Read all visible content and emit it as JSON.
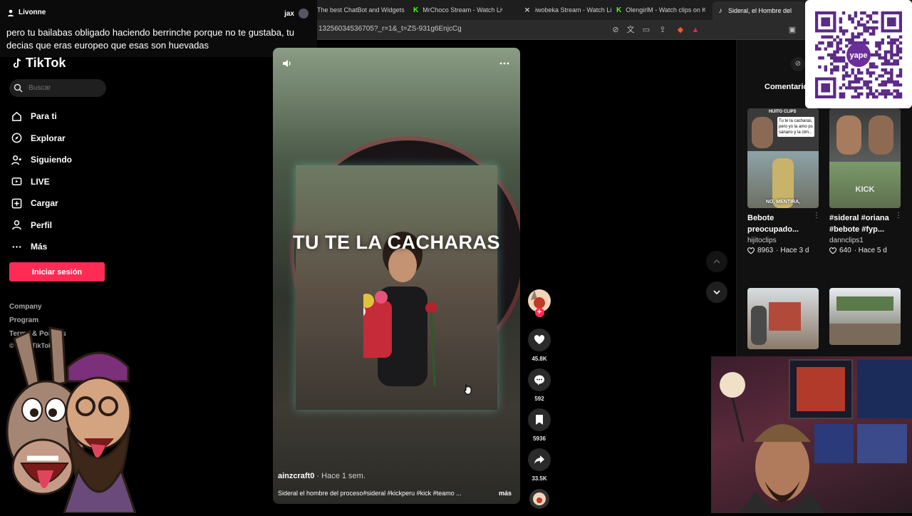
{
  "chat": {
    "user": "Livonne",
    "user2": "jax",
    "message": "pero tu bailabas obligado haciendo berrinche porque no te gustaba, tu decias que eras europeo que esas son huevadas"
  },
  "browser": {
    "tabs": [
      {
        "label": "The best ChatBot and Widgets"
      },
      {
        "label": "MrChoco Stream - Watch Live"
      },
      {
        "label": "iwobeka Stream - Watch Li"
      },
      {
        "label": "OlengirlM - Watch clips on Kic"
      },
      {
        "label": "Sideral, el Hombre del"
      }
    ],
    "url": "13256034536705?_r=1&_t=ZS-931g6EnjcCg"
  },
  "sidebar": {
    "logo": "TikTok",
    "search_placeholder": "Buscar",
    "items": [
      {
        "label": "Para ti",
        "icon": "home-icon"
      },
      {
        "label": "Explorar",
        "icon": "compass-icon"
      },
      {
        "label": "Siguiendo",
        "icon": "user-follow-icon"
      },
      {
        "label": "LIVE",
        "icon": "live-icon"
      },
      {
        "label": "Cargar",
        "icon": "upload-icon"
      },
      {
        "label": "Perfil",
        "icon": "profile-icon"
      },
      {
        "label": "Más",
        "icon": "more-icon"
      }
    ],
    "login_label": "Iniciar sesión",
    "footer": [
      "Company",
      "Program",
      "Terms & Policies",
      "© 2026 TikTok"
    ]
  },
  "video": {
    "overlay_text": "TU TE LA CACHARAS",
    "author": "ainzcraft0",
    "time": "· Hace 1 sem.",
    "caption": "Sideral el hombre del proceso#sideral #kickperu #kick #teamo ...",
    "more_label": "más"
  },
  "actions": [
    {
      "name": "like",
      "count": "45.8K"
    },
    {
      "name": "comment",
      "count": "592"
    },
    {
      "name": "save",
      "count": "5936"
    },
    {
      "name": "share",
      "count": "33.5K"
    }
  ],
  "right": {
    "tab_label": "Comentario",
    "related": [
      {
        "title": "Bebote preocupado...",
        "user": "hijitoclips",
        "likes": "8963",
        "age": "· Hace 3 d",
        "thumb_top": "HIJITO CLIPS",
        "thumb_text": "Tu te la cacharas, pero yo la amo ps sanano y la ctm...",
        "thumb_bottom": "NO, MENTIRA,"
      },
      {
        "title": "#sideral #oriana #bebote #fyp...",
        "user": "dannclips1",
        "likes": "640",
        "age": "· Hace 5 d",
        "thumb_bottom": "KICK"
      }
    ]
  },
  "colors": {
    "accent": "#fe2c55",
    "background": "#000000",
    "kick_green": "#53fc18"
  },
  "qr": {
    "brand": "yape"
  }
}
